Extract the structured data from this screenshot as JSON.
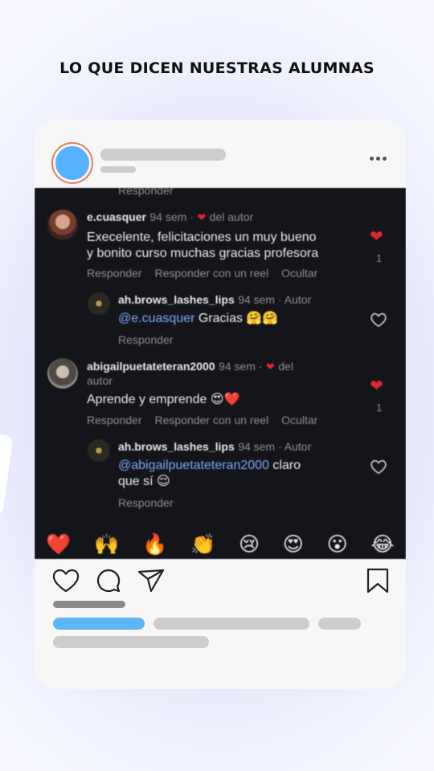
{
  "page": {
    "headline": "LO QUE DICEN NUESTRAS ALUMNAS",
    "colors": {
      "avatar": "#58b3ff",
      "avatar_ring": "#e8795a",
      "placeholder": "#cdcdcd",
      "accent_bar": "#5db5f5",
      "like_red": "#e2262d"
    }
  },
  "post": {
    "icons": [
      "more-icon",
      "heart-icon",
      "comment-icon",
      "share-icon",
      "bookmark-icon"
    ]
  },
  "screenshot": {
    "top_respond": "Responder",
    "comments": [
      {
        "user": "e.cuasquer",
        "meta": "94 sem ·",
        "author_like": "del autor",
        "text_line1": "Execelente, felicitaciones un muy bueno",
        "text_line2": "y bonito curso muchas gracias profesora",
        "actions": [
          "Responder",
          "Responder con un reel",
          "Ocultar"
        ],
        "like_count": "1",
        "reply": {
          "user": "ah.brows_lashes_lips",
          "meta": "94 sem · Autor",
          "mention": "@e.cuasquer",
          "text": " Gracias 🤗🤗",
          "action": "Responder"
        }
      },
      {
        "user": "abigailpuetateteran2000",
        "meta": "94 sem ·",
        "author_like": "del",
        "author_like2": "autor",
        "text_line1": "Aprende y emprende 😍❤️",
        "actions": [
          "Responder",
          "Responder con un reel",
          "Ocultar"
        ],
        "like_count": "1",
        "reply": {
          "user": "ah.brows_lashes_lips",
          "meta": "94 sem · Autor",
          "mention": "@abigailpuetateteran2000",
          "text": " claro",
          "text_line2": "que sí 😌",
          "action": "Responder"
        }
      }
    ],
    "reactions": [
      "❤️",
      "🙌",
      "🔥",
      "👏",
      "😢",
      "😍",
      "😮",
      "😂"
    ]
  }
}
